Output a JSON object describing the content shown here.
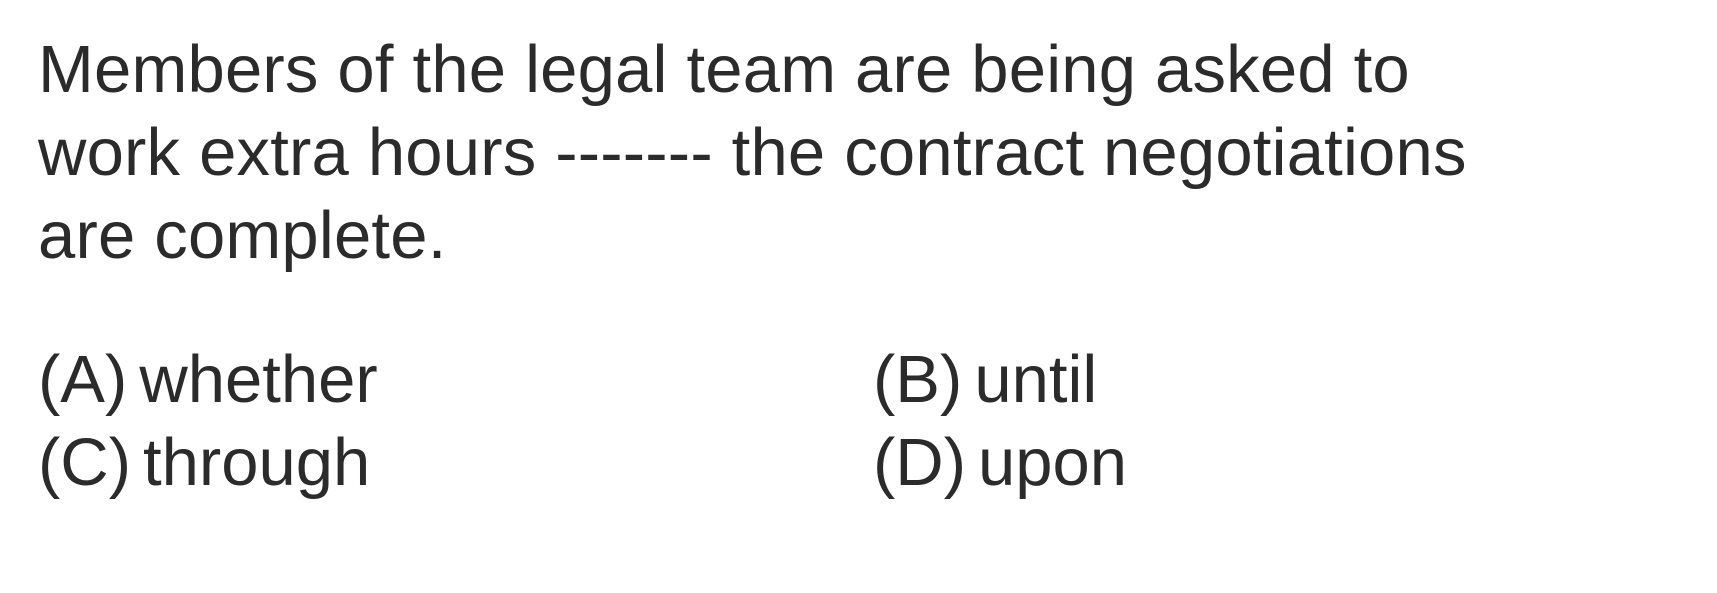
{
  "question": {
    "lines": [
      "Members of the legal team are being asked to",
      "work extra hours ------- the contract negotiations",
      "are complete."
    ]
  },
  "options": [
    {
      "letter": "(A)",
      "text": "whether"
    },
    {
      "letter": "(B)",
      "text": "until"
    },
    {
      "letter": "(C)",
      "text": "through"
    },
    {
      "letter": "(D)",
      "text": "upon"
    }
  ],
  "colors": {
    "text": "#2b2b2b",
    "background": "#ffffff"
  }
}
